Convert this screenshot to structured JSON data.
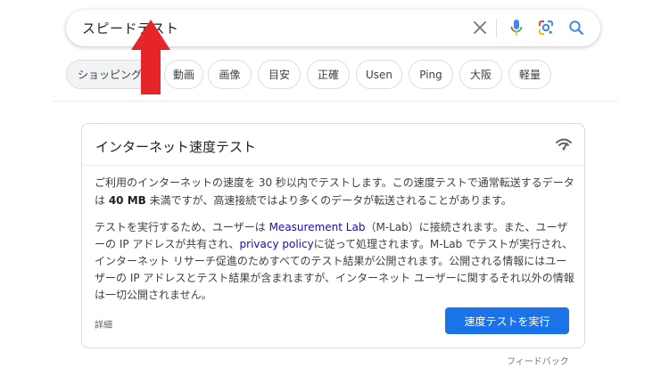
{
  "search": {
    "query": "スピードテスト",
    "icons": {
      "clear": "close-icon",
      "voice": "microphone-icon",
      "lens": "lens-icon",
      "search": "search-icon"
    }
  },
  "chips": [
    {
      "label": "ショッピング",
      "active": true
    },
    {
      "label": "動画"
    },
    {
      "label": "画像"
    },
    {
      "label": "目安"
    },
    {
      "label": "正確"
    },
    {
      "label": "Usen"
    },
    {
      "label": "Ping"
    },
    {
      "label": "大阪"
    },
    {
      "label": "軽量"
    }
  ],
  "annotation": {
    "color": "#e52528",
    "icon": "red-arrow"
  },
  "card": {
    "title": "インターネット速度テスト",
    "icon": "wifi-signal-icon",
    "para1_a": "ご利用のインターネットの速度を 30 秒以内でテストします。この速度テストで通常転送するデータは ",
    "para1_bold": "40 MB",
    "para1_b": " 未満ですが、高速接続ではより多くのデータが転送されることがあります。",
    "para2_a": "テストを実行するため、ユーザーは ",
    "para2_link1": "Measurement Lab",
    "para2_b": "（M-Lab）に接続されます。また、ユーザーの IP アドレスが共有され、",
    "para2_link2": "privacy policy",
    "para2_c": "に従って処理されます。M-Lab でテストが実行され、インターネット リサーチ促進のためすべてのテスト結果が公開されます。公開される情報にはユーザーの IP アドレスとテスト結果が含まれますが、インターネット ユーザーに関するそれ以外の情報は一切公開されません。",
    "details": "詳細",
    "run_button": "速度テストを実行"
  },
  "feedback": "フィードバック",
  "colors": {
    "accent": "#1a73e8",
    "link": "#1a0dab",
    "arrow": "#e52528"
  }
}
